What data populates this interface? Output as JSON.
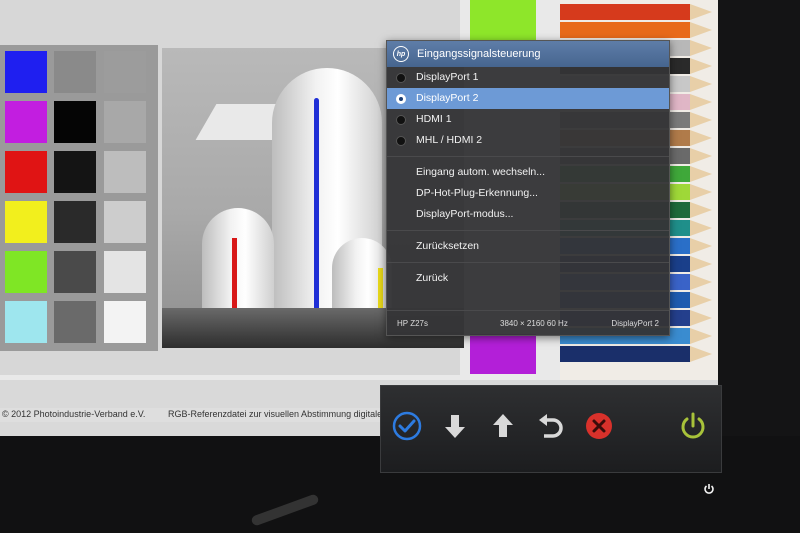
{
  "osd": {
    "title": "Eingangssignalsteuerung",
    "logo": "hp",
    "inputs": [
      {
        "label": "DisplayPort 1",
        "selected": false
      },
      {
        "label": "DisplayPort 2",
        "selected": true
      },
      {
        "label": "HDMI 1",
        "selected": false
      },
      {
        "label": "MHL / HDMI 2",
        "selected": false
      }
    ],
    "options": [
      {
        "label": "Eingang autom. wechseln..."
      },
      {
        "label": "DP-Hot-Plug-Erkennung..."
      },
      {
        "label": "DisplayPort-modus..."
      }
    ],
    "reset": "Zurücksetzen",
    "back": "Zurück",
    "footer": {
      "model": "HP Z27s",
      "resolution": "3840 × 2160  60 Hz",
      "input": "DisplayPort 2"
    }
  },
  "test_image": {
    "caption_left": "© 2012 Photoindustrie-Verband e.V.",
    "caption_right": "RGB-Referenzdatei zur visuellen Abstimmung digitaler Au"
  },
  "buttons": {
    "icons": [
      "checkmark-icon",
      "arrow-down-icon",
      "arrow-up-icon",
      "return-icon",
      "close-icon",
      "power-icon"
    ]
  },
  "colors": {
    "osd_accent": "#6d9ad6",
    "check": "#2d7be0",
    "close": "#d8312b",
    "power": "#a8c23a"
  }
}
